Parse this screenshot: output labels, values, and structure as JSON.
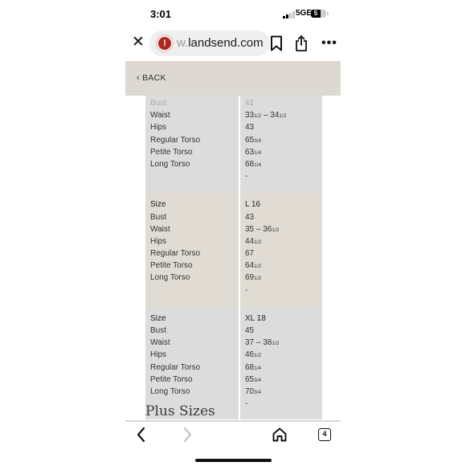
{
  "status_bar": {
    "time": "3:01",
    "network": "5GE",
    "battery": "5"
  },
  "browser": {
    "url_faded": "w.",
    "url_main": "landsend.com",
    "tab_count": "4"
  },
  "page": {
    "back_label": "BACK",
    "plus_heading": "Plus Sizes"
  },
  "size_chart": {
    "partial_top": {
      "rows": [
        {
          "label": "Bust",
          "value": "41"
        },
        {
          "label": "Waist",
          "value": "33",
          "frac1": "1/2",
          "sep": " – ",
          "value2": "34",
          "frac2": "1/2"
        },
        {
          "label": "Hips",
          "value": "43"
        },
        {
          "label": "Regular Torso",
          "value": "65",
          "frac1": "3/4"
        },
        {
          "label": "Petite Torso",
          "value": "63",
          "frac1": "1/4"
        },
        {
          "label": "Long Torso",
          "value": "68",
          "frac1": "1/4"
        },
        {
          "label": "",
          "value": "-"
        }
      ]
    },
    "blocks": [
      {
        "rows": [
          {
            "label": "Size",
            "value": "L 16"
          },
          {
            "label": "Bust",
            "value": "43"
          },
          {
            "label": "Waist",
            "value": "35",
            "sep": " – ",
            "value2": "36",
            "frac2": "1/2"
          },
          {
            "label": "Hips",
            "value": "44",
            "frac1": "1/2"
          },
          {
            "label": "Regular Torso",
            "value": "67"
          },
          {
            "label": "Petite Torso",
            "value": "64",
            "frac1": "1/2"
          },
          {
            "label": "Long Torso",
            "value": "69",
            "frac1": "1/2"
          },
          {
            "label": "",
            "value": "-"
          }
        ]
      },
      {
        "rows": [
          {
            "label": "Size",
            "value": "XL 18"
          },
          {
            "label": "Bust",
            "value": "45"
          },
          {
            "label": "Waist",
            "value": "37",
            "sep": " – ",
            "value2": "38",
            "frac2": "1/2"
          },
          {
            "label": "Hips",
            "value": "46",
            "frac1": "1/2"
          },
          {
            "label": "Regular Torso",
            "value": "68",
            "frac1": "1/4"
          },
          {
            "label": "Petite Torso",
            "value": "65",
            "frac1": "3/4"
          },
          {
            "label": "Long Torso",
            "value": "70",
            "frac1": "3/4"
          },
          {
            "label": "",
            "value": "-"
          }
        ]
      }
    ]
  },
  "colors": {
    "header_bg": "#ddd9d2",
    "gray_block": "#dcdcdc",
    "tan_block": "#e0dcd4",
    "warning_icon": "#b3261e"
  },
  "icons": {
    "close": "close-icon",
    "warning": "warning-icon",
    "bookmark": "bookmark-icon",
    "share": "share-icon",
    "more": "more-icon",
    "back_nav": "chevron-left-icon",
    "forward_nav": "chevron-right-icon",
    "home": "home-icon",
    "tabs": "tabs-icon"
  }
}
